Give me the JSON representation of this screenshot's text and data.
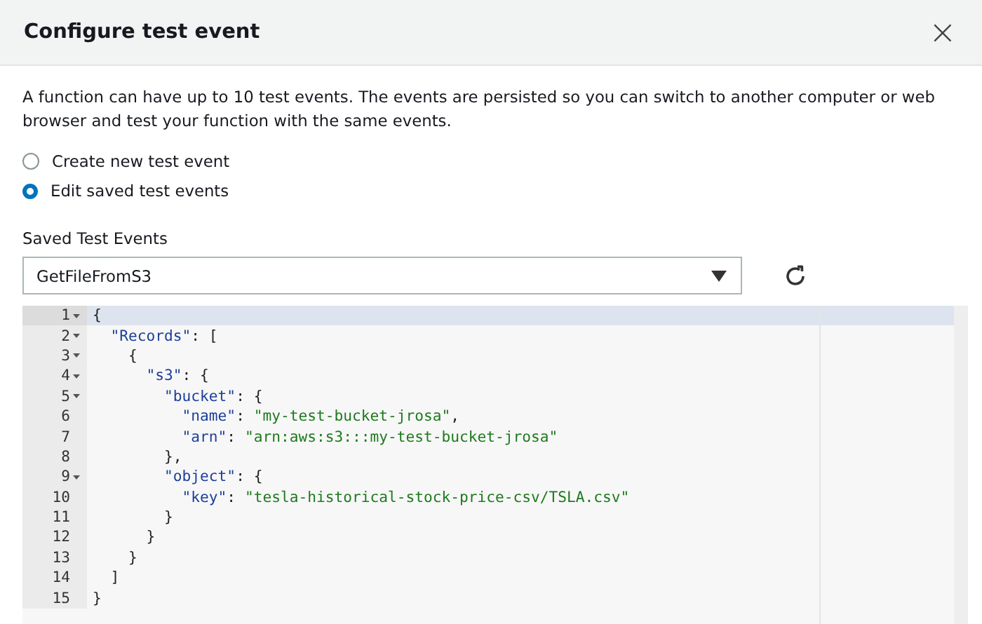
{
  "dialog": {
    "title": "Configure test event",
    "close_icon": "×"
  },
  "description": "A function can have up to 10 test events. The events are persisted so you can switch to another computer or web browser and test your function with the same events.",
  "options": [
    {
      "label": "Create new test event",
      "selected": false
    },
    {
      "label": "Edit saved test events",
      "selected": true
    }
  ],
  "saved_events": {
    "label": "Saved Test Events",
    "value": "GetFileFromS3"
  },
  "editor": {
    "lines": [
      {
        "number": "1",
        "foldable": true,
        "active": true,
        "tokens": [
          {
            "kind": "punct",
            "text": "{"
          }
        ]
      },
      {
        "number": "2",
        "foldable": true,
        "active": false,
        "tokens": [
          {
            "kind": "key",
            "text": "  \"Records\""
          },
          {
            "kind": "punct",
            "text": ": ["
          }
        ]
      },
      {
        "number": "3",
        "foldable": true,
        "active": false,
        "tokens": [
          {
            "kind": "punct",
            "text": "    {"
          }
        ]
      },
      {
        "number": "4",
        "foldable": true,
        "active": false,
        "tokens": [
          {
            "kind": "key",
            "text": "      \"s3\""
          },
          {
            "kind": "punct",
            "text": ": {"
          }
        ]
      },
      {
        "number": "5",
        "foldable": true,
        "active": false,
        "tokens": [
          {
            "kind": "key",
            "text": "        \"bucket\""
          },
          {
            "kind": "punct",
            "text": ": {"
          }
        ]
      },
      {
        "number": "6",
        "foldable": false,
        "active": false,
        "tokens": [
          {
            "kind": "key",
            "text": "          \"name\""
          },
          {
            "kind": "punct",
            "text": ": "
          },
          {
            "kind": "string",
            "text": "\"my-test-bucket-jrosa\""
          },
          {
            "kind": "punct",
            "text": ","
          }
        ]
      },
      {
        "number": "7",
        "foldable": false,
        "active": false,
        "tokens": [
          {
            "kind": "key",
            "text": "          \"arn\""
          },
          {
            "kind": "punct",
            "text": ": "
          },
          {
            "kind": "string",
            "text": "\"arn:aws:s3:::my-test-bucket-jrosa\""
          }
        ]
      },
      {
        "number": "8",
        "foldable": false,
        "active": false,
        "tokens": [
          {
            "kind": "punct",
            "text": "        },"
          }
        ]
      },
      {
        "number": "9",
        "foldable": true,
        "active": false,
        "tokens": [
          {
            "kind": "key",
            "text": "        \"object\""
          },
          {
            "kind": "punct",
            "text": ": {"
          }
        ]
      },
      {
        "number": "10",
        "foldable": false,
        "active": false,
        "tokens": [
          {
            "kind": "key",
            "text": "          \"key\""
          },
          {
            "kind": "punct",
            "text": ": "
          },
          {
            "kind": "string",
            "text": "\"tesla-historical-stock-price-csv/TSLA.csv\""
          }
        ]
      },
      {
        "number": "11",
        "foldable": false,
        "active": false,
        "tokens": [
          {
            "kind": "punct",
            "text": "        }"
          }
        ]
      },
      {
        "number": "12",
        "foldable": false,
        "active": false,
        "tokens": [
          {
            "kind": "punct",
            "text": "      }"
          }
        ]
      },
      {
        "number": "13",
        "foldable": false,
        "active": false,
        "tokens": [
          {
            "kind": "punct",
            "text": "    }"
          }
        ]
      },
      {
        "number": "14",
        "foldable": false,
        "active": false,
        "tokens": [
          {
            "kind": "punct",
            "text": "  ]"
          }
        ]
      },
      {
        "number": "15",
        "foldable": false,
        "active": false,
        "tokens": [
          {
            "kind": "punct",
            "text": "}"
          }
        ]
      }
    ]
  }
}
